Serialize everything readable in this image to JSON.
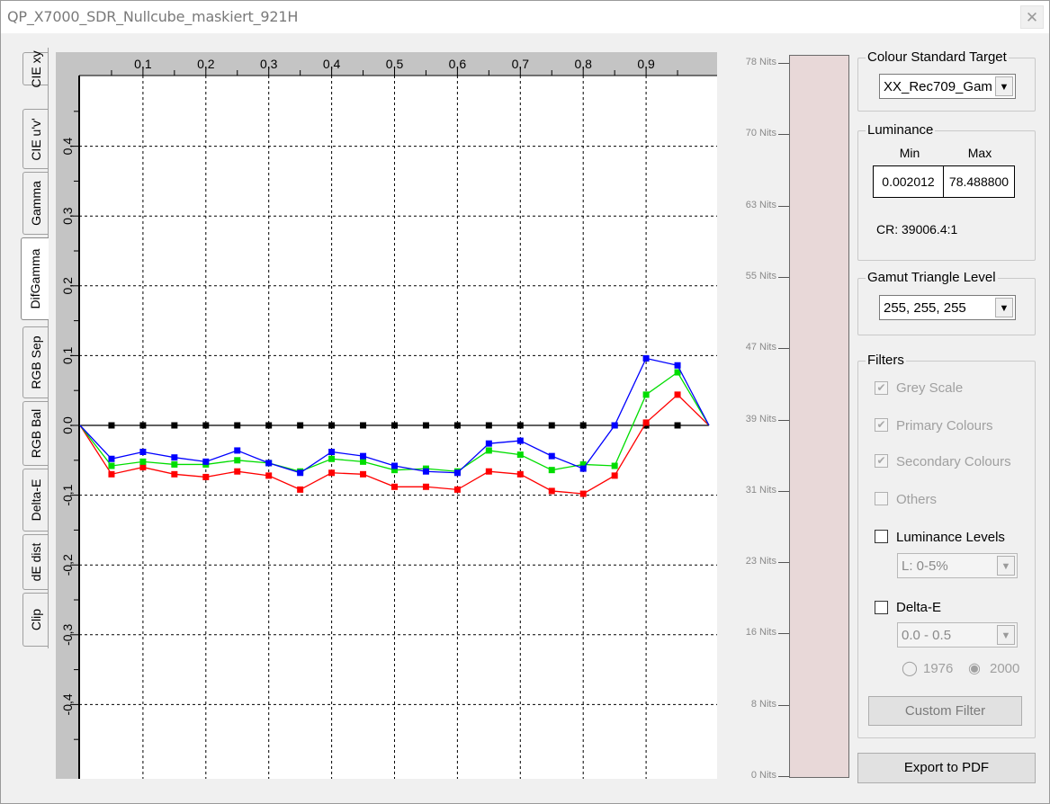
{
  "window": {
    "title": "QP_X7000_SDR_Nullcube_maskiert_921H",
    "close_glyph": "✕"
  },
  "tabs": [
    {
      "label": "CIE xy",
      "active": false
    },
    {
      "label": "CIE u'v'",
      "active": false
    },
    {
      "label": "Gamma",
      "active": false
    },
    {
      "label": "DifGamma",
      "active": true
    },
    {
      "label": "RGB Sep",
      "active": false
    },
    {
      "label": "RGB Bal",
      "active": false
    },
    {
      "label": "Delta-E",
      "active": false
    },
    {
      "label": "dE dist",
      "active": false
    },
    {
      "label": "Clip",
      "active": false
    }
  ],
  "chart_data": {
    "type": "line",
    "title": "",
    "xlabel": "",
    "ylabel": "",
    "x_ticks": [
      "0,1",
      "0,2",
      "0,3",
      "0,4",
      "0,5",
      "0,6",
      "0,7",
      "0,8",
      "0,9"
    ],
    "y_ticks": [
      "0,4",
      "0,3",
      "0,2",
      "0,1",
      "0,0",
      "-0,1",
      "-0,2",
      "-0,3",
      "-0,4"
    ],
    "xlim": [
      0,
      1
    ],
    "ylim": [
      -0.5,
      0.5
    ],
    "grid": true,
    "x": [
      0,
      0.05,
      0.1,
      0.15,
      0.2,
      0.25,
      0.3,
      0.35,
      0.4,
      0.45,
      0.5,
      0.55,
      0.6,
      0.65,
      0.7,
      0.75,
      0.8,
      0.85,
      0.9,
      0.95,
      1.0
    ],
    "series": [
      {
        "color": "#0000ff",
        "values": [
          0.0,
          -0.048,
          -0.038,
          -0.046,
          -0.052,
          -0.036,
          -0.054,
          -0.068,
          -0.038,
          -0.044,
          -0.058,
          -0.066,
          -0.068,
          -0.026,
          -0.022,
          -0.044,
          -0.062,
          0.0,
          0.096,
          0.086,
          0.0
        ]
      },
      {
        "color": "#00dd00",
        "values": [
          0.0,
          -0.058,
          -0.052,
          -0.056,
          -0.056,
          -0.05,
          -0.054,
          -0.066,
          -0.048,
          -0.052,
          -0.064,
          -0.062,
          -0.066,
          -0.036,
          -0.042,
          -0.064,
          -0.056,
          -0.058,
          0.044,
          0.076,
          0.0
        ]
      },
      {
        "color": "#ff0000",
        "values": [
          0.0,
          -0.07,
          -0.06,
          -0.07,
          -0.074,
          -0.066,
          -0.072,
          -0.092,
          -0.068,
          -0.07,
          -0.088,
          -0.088,
          -0.092,
          -0.066,
          -0.07,
          -0.094,
          -0.098,
          -0.072,
          0.004,
          0.044,
          0.0
        ]
      },
      {
        "color": "#000000",
        "values": [
          0,
          0,
          0,
          0,
          0,
          0,
          0,
          0,
          0,
          0,
          0,
          0,
          0,
          0,
          0,
          0,
          0,
          0,
          0,
          0,
          0
        ]
      }
    ]
  },
  "nits_scale": {
    "labels": [
      "78 Nits",
      "70 Nits",
      "63 Nits",
      "55 Nits",
      "47 Nits",
      "39 Nits",
      "31 Nits",
      "23 Nits",
      "16 Nits",
      "8 Nits",
      "0 Nits"
    ],
    "bar_color": "#e8d8d8"
  },
  "colour_standard": {
    "legend": "Colour Standard Target",
    "value": "XX_Rec709_Gam"
  },
  "luminance": {
    "legend": "Luminance",
    "min_label": "Min",
    "max_label": "Max",
    "min_value": "0.002012",
    "max_value": "78.488800",
    "cr": "CR: 39006.4:1"
  },
  "gamut": {
    "legend": "Gamut Triangle Level",
    "value": "255, 255, 255"
  },
  "filters": {
    "legend": "Filters",
    "grey_scale": "Grey Scale",
    "primary": "Primary Colours",
    "secondary": "Secondary Colours",
    "others": "Others",
    "luminance_levels": "Luminance Levels",
    "luminance_levels_value": "L:   0-5%",
    "delta_e": "Delta-E",
    "delta_e_value": "0.0 - 0.5",
    "radio_1976": "1976",
    "radio_2000": "2000",
    "custom_filter": "Custom Filter"
  },
  "export_button": "Export to PDF",
  "combo_arrow": "▼",
  "check_glyph": "✔",
  "radio_off": "◯",
  "radio_on": "◉"
}
